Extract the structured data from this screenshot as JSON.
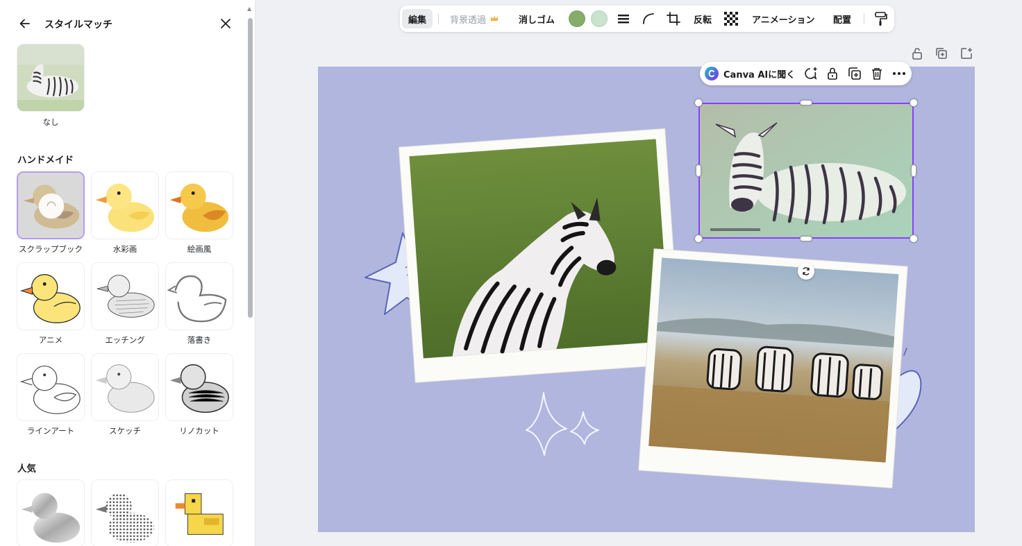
{
  "panel": {
    "title": "スタイルマッチ",
    "none_label": "なし",
    "sections": [
      {
        "title": "ハンドメイド",
        "items": [
          {
            "label": "スクラップブック",
            "selected": true
          },
          {
            "label": "水彩画"
          },
          {
            "label": "絵画風"
          },
          {
            "label": "アニメ"
          },
          {
            "label": "エッチング"
          },
          {
            "label": "落書き"
          },
          {
            "label": "ラインアート"
          },
          {
            "label": "スケッチ"
          },
          {
            "label": "リノカット"
          }
        ]
      },
      {
        "title": "人気",
        "items": [
          {
            "label": ""
          },
          {
            "label": ""
          },
          {
            "label": ""
          }
        ]
      }
    ]
  },
  "toolbar": {
    "edit": "編集",
    "bg_remove": "背景透過",
    "eraser": "消しゴム",
    "swatch_colors": [
      "#86ac6a",
      "#c8e4cd"
    ],
    "flip": "反転",
    "animation": "アニメーション",
    "arrange": "配置"
  },
  "ai_bar": {
    "label": "Canva AIに聞く"
  },
  "colors": {
    "canvas_bg": "#b1b6df",
    "selection": "#8b3dff",
    "accent_selected_thumb": "#b49cf0"
  }
}
